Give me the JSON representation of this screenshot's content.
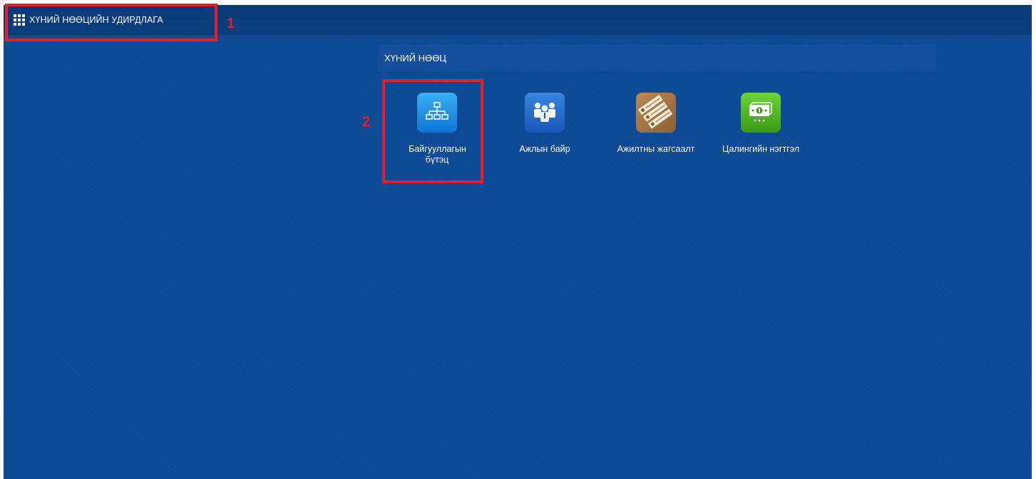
{
  "topbar": {
    "title": "ХҮНИЙ НӨӨЦИЙН УДИРДЛАГА",
    "launcher_icon": "grid-icon"
  },
  "section": {
    "title": "ХҮНИЙ НӨӨЦ"
  },
  "tiles": [
    {
      "label": "Байгууллагын бүтэц",
      "icon": "org-structure-icon",
      "color": "#1E8FE8"
    },
    {
      "label": "Ажлын байр",
      "icon": "people-icon",
      "color": "#2A6FD0"
    },
    {
      "label": "Ажилтны жагсаалт",
      "icon": "document-list-icon",
      "color": "#A97845"
    },
    {
      "label": "Цалингийн нэгтгэл",
      "icon": "money-icon",
      "color": "#4FB521"
    }
  ],
  "annotations": {
    "marker_1": "1",
    "marker_2": "2",
    "highlight_color": "#E3202E"
  },
  "colors": {
    "background": "#0C4A96",
    "topbar": "#0A3A78"
  }
}
